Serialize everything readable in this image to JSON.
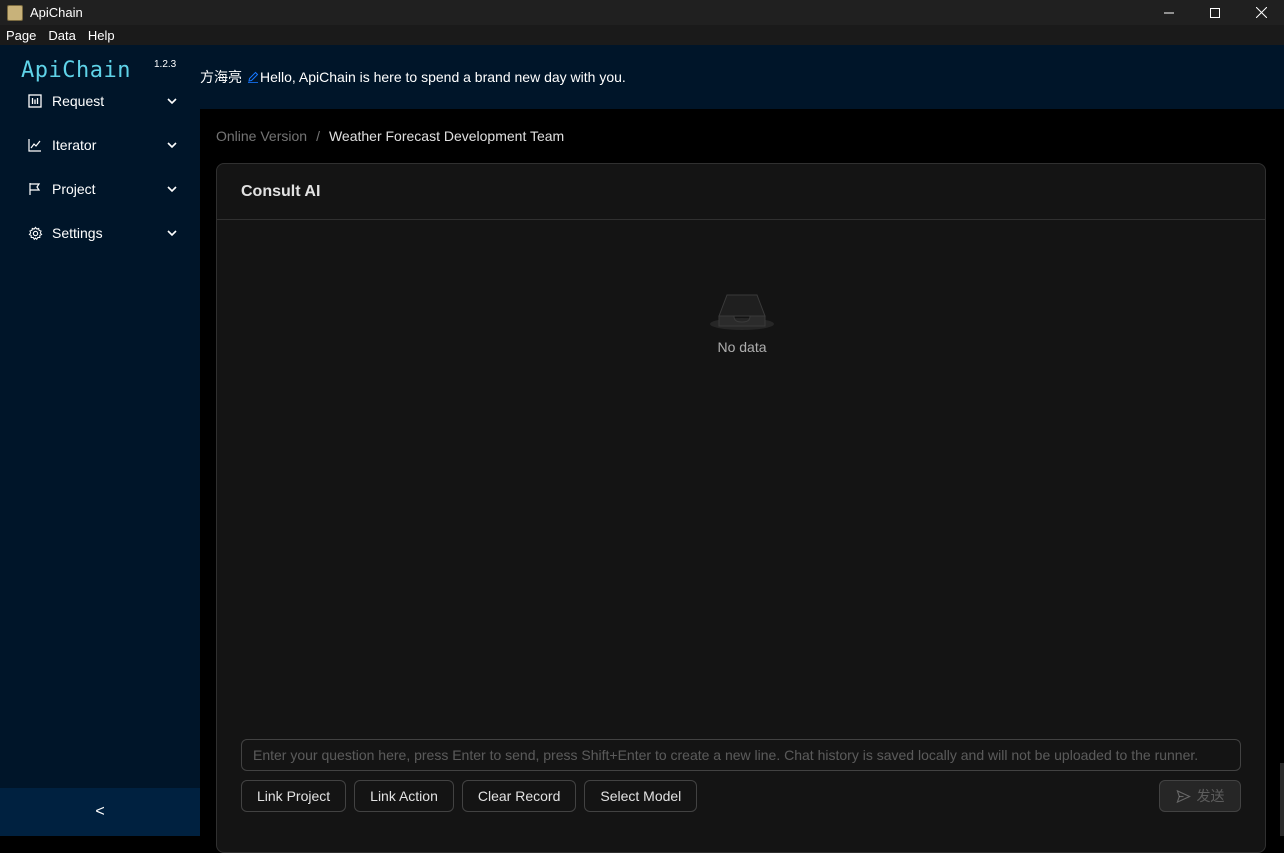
{
  "window": {
    "title": "ApiChain"
  },
  "menu": {
    "items": [
      "Page",
      "Data",
      "Help"
    ]
  },
  "sidebar": {
    "logo": "ApiChain",
    "version": "1.2.3",
    "items": [
      {
        "label": "Request",
        "icon": "request-icon"
      },
      {
        "label": "Iterator",
        "icon": "chart-line-icon"
      },
      {
        "label": "Project",
        "icon": "flag-icon"
      },
      {
        "label": "Settings",
        "icon": "gear-icon"
      }
    ],
    "collapse_glyph": "<"
  },
  "header": {
    "user_name": "方海亮",
    "greeting": "Hello, ApiChain is here to spend a brand new day with you."
  },
  "breadcrumb": {
    "items": [
      "Online Version",
      "Weather Forecast Development Team"
    ],
    "separator": "/"
  },
  "card": {
    "title": "Consult AI",
    "empty_text": "No data"
  },
  "chat": {
    "placeholder": "Enter your question here, press Enter to send, press Shift+Enter to create a new line. Chat history is saved locally and will not be uploaded to the runner.",
    "value": ""
  },
  "actions": {
    "link_project": "Link Project",
    "link_action": "Link Action",
    "clear_record": "Clear Record",
    "select_model": "Select Model",
    "send": "发送"
  },
  "colors": {
    "sidebar_bg": "#001529",
    "logo": "#5fd3e8",
    "accent": "#1677ff",
    "card_bg": "#141414"
  }
}
